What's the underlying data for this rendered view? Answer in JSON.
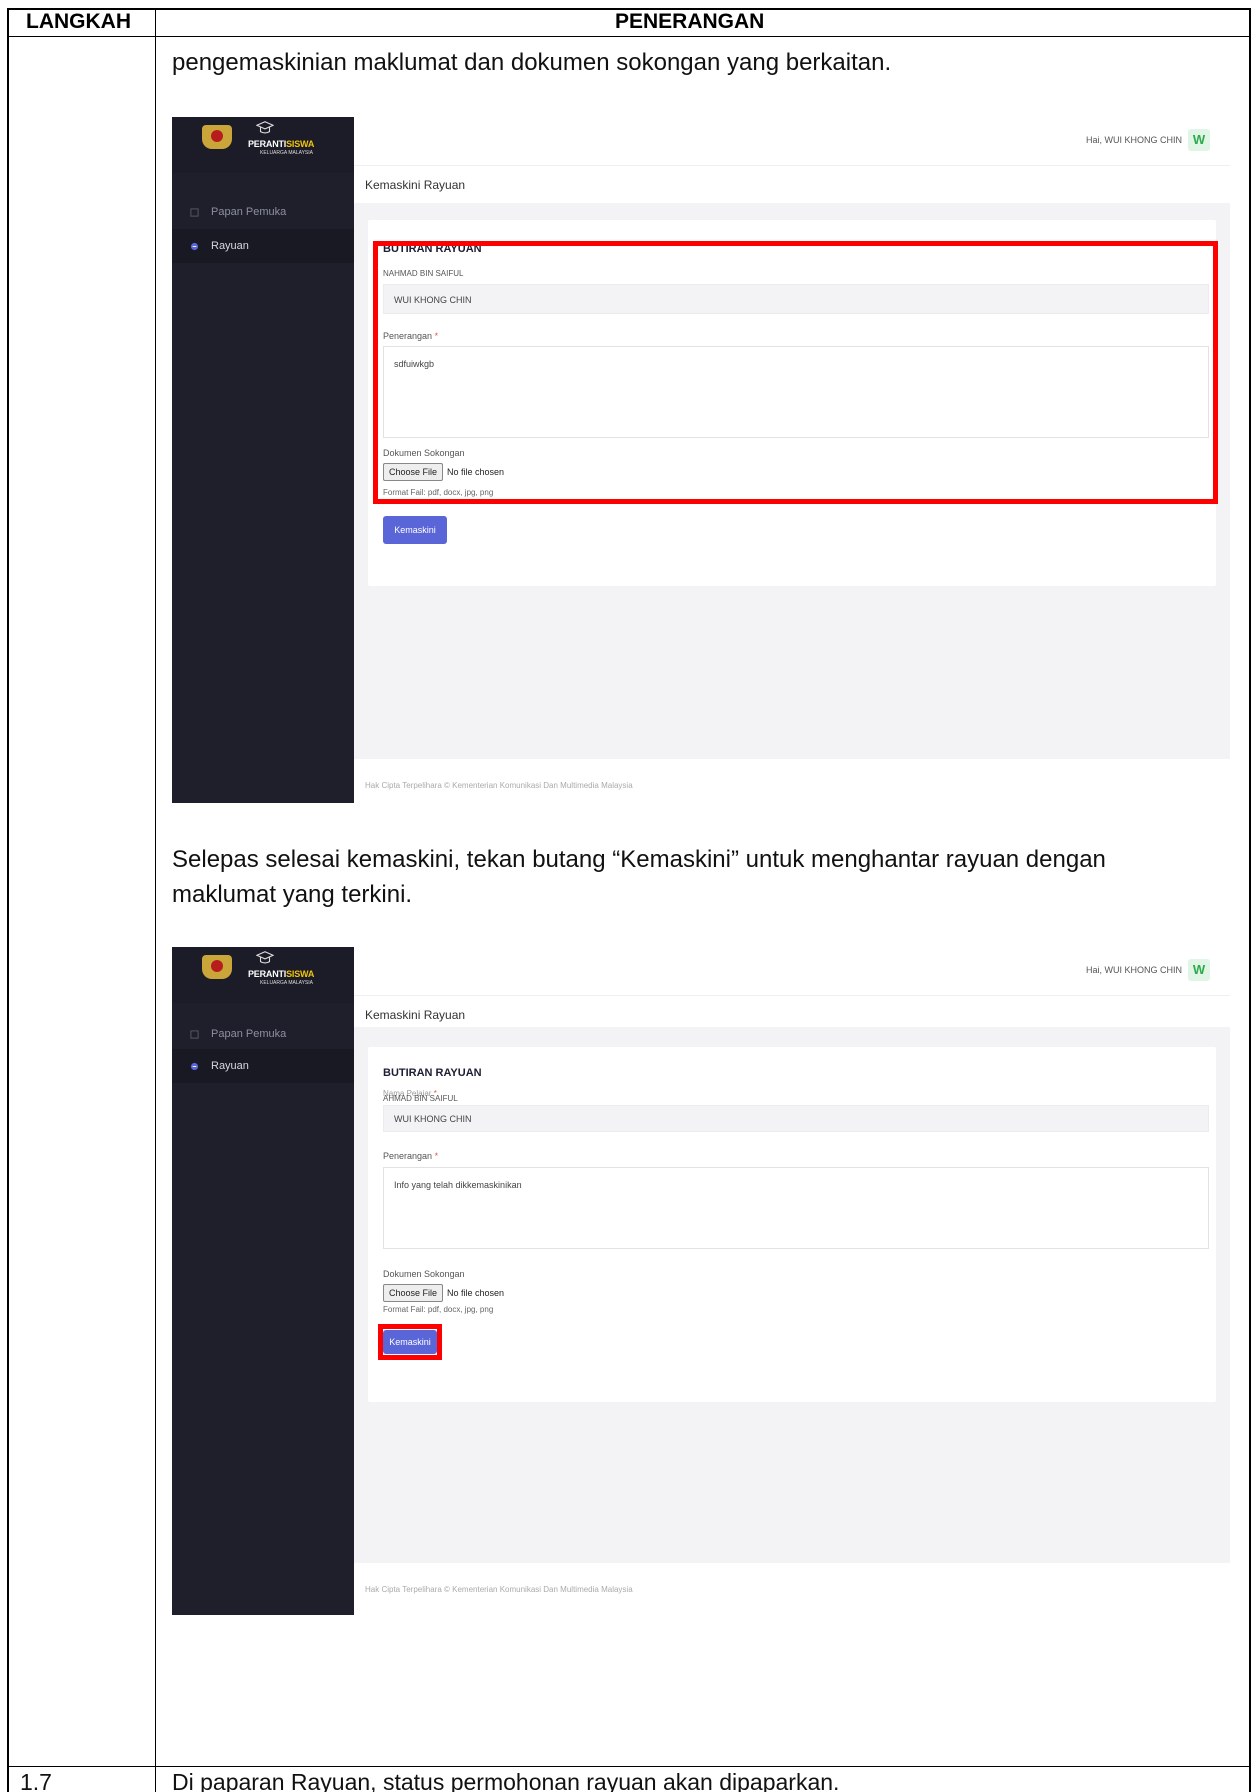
{
  "table": {
    "col_step": "LANGKAH",
    "col_desc": "PENERANGAN",
    "next_step_number": "1.7",
    "next_step_text": "Di paparan Rayuan, status permohonan rayuan akan dipaparkan."
  },
  "paragraphs": {
    "intro": "pengemaskinian maklumat dan dokumen sokongan yang berkaitan.",
    "after_first_line1": "Selepas selesai kemaskini, tekan butang “Kemaskini” untuk menghantar rayuan dengan",
    "after_first_line2": "maklumat yang terkini."
  },
  "screenshot_1": {
    "logo_title_a": "PERANTI",
    "logo_title_b": "SISWA",
    "logo_sub": "KELUARGA MALAYSIA",
    "greeting": "Hai, WUI KHONG CHIN",
    "avatar_letter": "W",
    "nav": [
      "Papan Pemuka",
      "Rayuan"
    ],
    "page_title": "Kemaskini Rayuan",
    "card_title": "BUTIRAN RAYUAN",
    "name_label": "NAHMAD BIN SAIFUL",
    "name_value": "WUI KHONG CHIN",
    "desc_label": "Penerangan",
    "desc_value": "sdfuiwkgb",
    "doc_label": "Dokumen Sokongan",
    "file_button": "Choose File",
    "file_status": "No file chosen",
    "format_hint": "Format Fail: pdf, docx, jpg, png",
    "submit": "Kemaskini",
    "footer": "Hak Cipta Terpelihara © Kementerian Komunikasi Dan Multimedia Malaysia"
  },
  "screenshot_2": {
    "logo_title_a": "PERANTI",
    "logo_title_b": "SISWA",
    "logo_sub": "KELUARGA MALAYSIA",
    "greeting": "Hai, WUI KHONG CHIN",
    "avatar_letter": "W",
    "nav": [
      "Papan Pemuka",
      "Rayuan"
    ],
    "page_title": "Kemaskini Rayuan",
    "card_title": "BUTIRAN RAYUAN",
    "name_label": "Nama Pelajar",
    "name_overlay": "AHMAD BIN SAIFUL",
    "name_value": "WUI KHONG CHIN",
    "desc_label": "Penerangan",
    "desc_value": "Info yang telah dikkemaskinikan",
    "doc_label": "Dokumen Sokongan",
    "file_button": "Choose File",
    "file_status": "No file chosen",
    "format_hint": "Format Fail: pdf, docx, jpg, png",
    "submit": "Kemaskini",
    "footer": "Hak Cipta Terpelihara © Kementerian Komunikasi Dan Multimedia Malaysia"
  },
  "colors": {
    "sidebar": "#1e1f2b",
    "highlight": "#ff0000",
    "button": "#5a66d8",
    "avatar_text": "#2eaa4a"
  }
}
